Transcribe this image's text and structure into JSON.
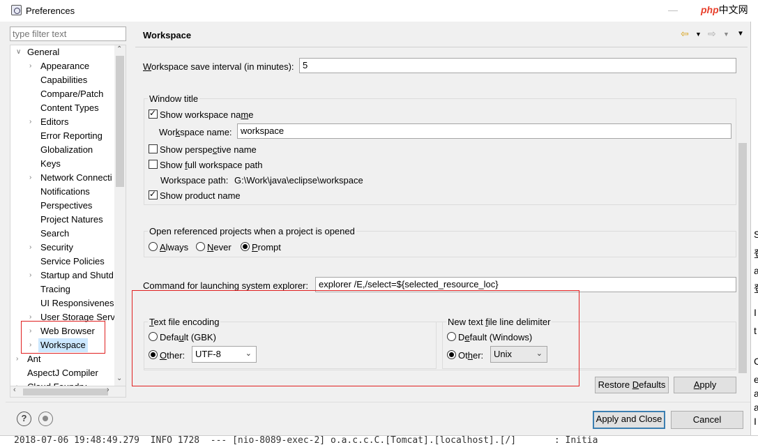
{
  "window": {
    "title": "Preferences",
    "minimize_glyph": "—",
    "maximize_glyph": "☐"
  },
  "overlay": {
    "site_logo_text": "php",
    "site_logo_suffix": "中文网"
  },
  "filter": {
    "placeholder": "type filter text"
  },
  "tree": {
    "items": [
      {
        "label": "General",
        "expanded": true
      },
      {
        "label": "Appearance",
        "has_children": true
      },
      {
        "label": "Capabilities"
      },
      {
        "label": "Compare/Patch"
      },
      {
        "label": "Content Types"
      },
      {
        "label": "Editors",
        "has_children": true
      },
      {
        "label": "Error Reporting"
      },
      {
        "label": "Globalization"
      },
      {
        "label": "Keys"
      },
      {
        "label": "Network Connecti",
        "has_children": true
      },
      {
        "label": "Notifications"
      },
      {
        "label": "Perspectives"
      },
      {
        "label": "Project Natures"
      },
      {
        "label": "Search"
      },
      {
        "label": "Security",
        "has_children": true
      },
      {
        "label": "Service Policies"
      },
      {
        "label": "Startup and Shutd",
        "has_children": true
      },
      {
        "label": "Tracing"
      },
      {
        "label": "UI Responsiveness"
      },
      {
        "label": "User Storage Serv",
        "has_children": true
      },
      {
        "label": "Web Browser",
        "has_children": true
      },
      {
        "label": "Workspace",
        "has_children": true,
        "selected": true
      },
      {
        "label": "Ant",
        "has_children": true
      },
      {
        "label": "AspectJ Compiler"
      },
      {
        "label": "Cloud Foundry",
        "has_children": true
      }
    ],
    "icons": [
      "chevron-right-icon",
      "chevron-down-icon"
    ]
  },
  "page": {
    "title": "Workspace",
    "save_interval": {
      "label_u": "W",
      "label_rest": "orkspace save interval (in minutes):",
      "value": "5"
    },
    "window_title": {
      "group_label": "Window title",
      "show_workspace_name": {
        "label_pre": "Show workspace na",
        "label_u": "m",
        "label_post": "e",
        "checked": true
      },
      "workspace_name": {
        "label_pre": "Wor",
        "label_u": "k",
        "label_post": "space name:",
        "value": "workspace"
      },
      "show_perspective_name": {
        "label_pre": "Show perspe",
        "label_u": "c",
        "label_post": "tive name",
        "checked": false
      },
      "show_full_path": {
        "label_pre": "Show ",
        "label_u": "f",
        "label_post": "ull workspace path",
        "checked": false
      },
      "workspace_path": {
        "label": "Workspace path:",
        "value": "G:\\Work\\java\\eclipse\\workspace"
      },
      "show_product_name": {
        "label": "Show product name",
        "checked": true
      }
    },
    "open_referenced": {
      "group_label": "Open referenced projects when a project is opened",
      "always": {
        "label_u": "A",
        "label_rest": "lways",
        "checked": false
      },
      "never": {
        "label_u": "N",
        "label_rest": "ever",
        "checked": false
      },
      "prompt": {
        "label_u": "P",
        "label_rest": "rompt",
        "checked": true
      }
    },
    "explorer_command": {
      "label": "Command for launching system explorer:",
      "value": "explorer /E,/select=${selected_resource_loc}"
    },
    "text_encoding": {
      "group_label_u": "T",
      "group_label_rest": "ext file encoding",
      "default": {
        "label_pre": "Defa",
        "label_u": "u",
        "label_post": "lt (GBK)",
        "checked": false
      },
      "other": {
        "label_pre": "",
        "label_u": "O",
        "label_post": "ther:",
        "checked": true,
        "value": "UTF-8"
      }
    },
    "line_delimiter": {
      "group_label_pre": "New text ",
      "group_label_u": "f",
      "group_label_post": "ile line delimiter",
      "default": {
        "label_pre": "D",
        "label_u": "e",
        "label_post": "fault (Windows)",
        "checked": false
      },
      "other": {
        "label_pre": "Ot",
        "label_u": "h",
        "label_post": "er:",
        "checked": true,
        "value": "Unix"
      }
    },
    "restore_defaults": {
      "label_pre": "Restore ",
      "label_u": "D",
      "label_post": "efaults"
    },
    "apply": {
      "label_u": "A",
      "label_rest": "pply"
    }
  },
  "footer": {
    "help_glyph": "?",
    "apply_and_close": "Apply and Close",
    "cancel": "Cancel"
  },
  "background": {
    "right_edge_chars": [
      "S",
      "登",
      "a",
      "登",
      "I",
      "t",
      "C",
      "e",
      "a",
      "a",
      "I"
    ],
    "console_text": "2018-07-06 19:48:49.279  INFO 1728  --- [nio-8089-exec-2] o.a.c.c.C.[Tomcat].[localhost].[/]       : Initia"
  },
  "colors": {
    "selection": "#cce8ff",
    "highlight_box": "#e02020",
    "default_button_border": "#3c7fb1"
  }
}
